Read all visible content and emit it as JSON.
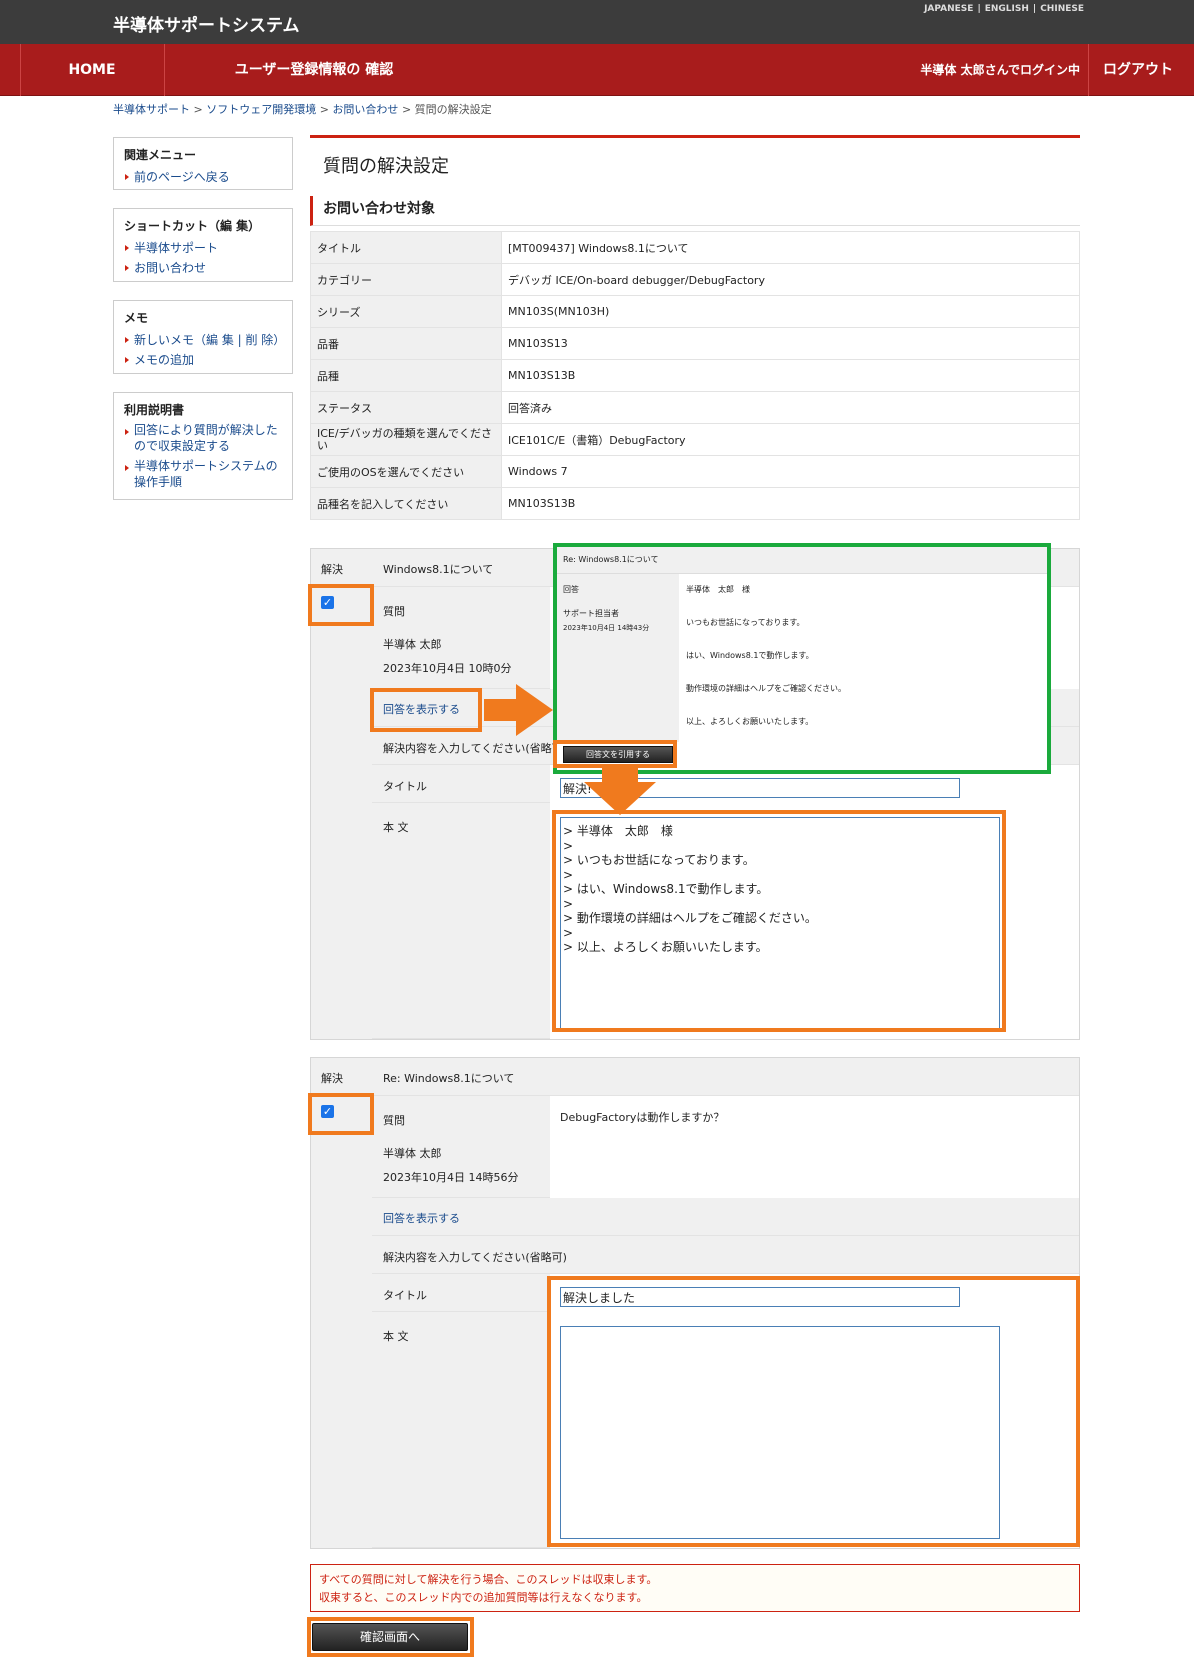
{
  "header": {
    "site_title": "半導体サポートシステム",
    "lang_japanese": "JAPANESE",
    "lang_english": "ENGLISH",
    "lang_chinese": "CHINESE"
  },
  "nav": {
    "home": "HOME",
    "user_info": "ユーザー登録情報の 確認",
    "login_status": "半導体 太郎さんでログイン中",
    "logout": "ログアウト"
  },
  "breadcrumb": {
    "b1": "半導体サポート",
    "b2": "ソフトウェア開発環境",
    "b3": "お問い合わせ",
    "b4": "質問の解決設定",
    "sep": ">"
  },
  "sidebar": {
    "related_title": "関連メニュー",
    "related_back": "前のページへ戻る",
    "shortcut_title": "ショートカット（編 集）",
    "shortcut_1": "半導体サポート",
    "shortcut_2": "お問い合わせ",
    "memo_title": "メモ",
    "memo_new": "新しいメモ（編 集 | 削 除）",
    "memo_add": "メモの追加",
    "manual_title": "利用説明書",
    "manual_1": "回答により質問が解決したので収束設定する",
    "manual_2": "半導体サポートシステムの操作手順"
  },
  "page": {
    "title": "質問の解決設定",
    "section_title": "お問い合わせ対象"
  },
  "info_rows": [
    {
      "k": "タイトル",
      "v": "[MT009437] Windows8.1について"
    },
    {
      "k": "カテゴリー",
      "v": "デバッガ ICE/On-board debugger/DebugFactory"
    },
    {
      "k": "シリーズ",
      "v": "MN103S(MN103H)"
    },
    {
      "k": "品番",
      "v": "MN103S13"
    },
    {
      "k": "品種",
      "v": "MN103S13B"
    },
    {
      "k": "ステータス",
      "v": "回答済み"
    },
    {
      "k": "ICE/デバッガの種類を選んでください",
      "v": "ICE101C/E（書箱）DebugFactory"
    },
    {
      "k": "ご使用のOSを選んでください",
      "v": "Windows 7"
    },
    {
      "k": "品種名を記入してください",
      "v": "MN103S13B"
    }
  ],
  "block1": {
    "resolve_label": "解決",
    "subject": "Windows8.1について",
    "question_label": "質問",
    "author": "半導体 太郎",
    "date": "2023年10月4日 10時0分",
    "show_answer": "回答を表示する",
    "resolve_prompt": "解決内容を入力してください(省略可)",
    "title_label": "タイトル",
    "title_value": "解決!",
    "body_label": "本 文",
    "body_value": "> 半導体　太郎　様\n>\n> いつもお世話になっております。\n>\n> はい、Windows8.1で動作します。\n>\n> 動作環境の詳細はヘルプをご確認ください。\n>\n> 以上、よろしくお願いいたします。"
  },
  "popup": {
    "title": "Re: Windows8.1について",
    "label_answer": "回答",
    "label_staff": "サポート担当者",
    "date": "2023年10月4日 14時43分",
    "line1": "半導体　太郎　様",
    "line2": "いつもお世話になっております。",
    "line3": "はい、Windows8.1で動作します。",
    "line4": "動作環境の詳細はヘルプをご確認ください。",
    "line5": "以上、よろしくお願いいたします。",
    "quote_button": "回答文を引用する"
  },
  "block2": {
    "resolve_label": "解決",
    "subject": "Re: Windows8.1について",
    "question_label": "質問",
    "question_text": "DebugFactoryは動作しますか？",
    "author": "半導体 太郎",
    "date": "2023年10月4日 14時56分",
    "show_answer": "回答を表示する",
    "resolve_prompt": "解決内容を入力してください(省略可)",
    "title_label": "タイトル",
    "title_value": "解決しました",
    "body_label": "本 文",
    "body_value": ""
  },
  "notice": {
    "line1": "すべての質問に対して解決を行う場合、このスレッドは収束します。",
    "line2": "収束すると、このスレッド内での追加質問等は行えなくなります。"
  },
  "confirm_button": "確認画面へ",
  "colors": {
    "nav": "#a81c1c",
    "highlight_orange": "#f07a1e",
    "highlight_green": "#1aaa3c"
  }
}
